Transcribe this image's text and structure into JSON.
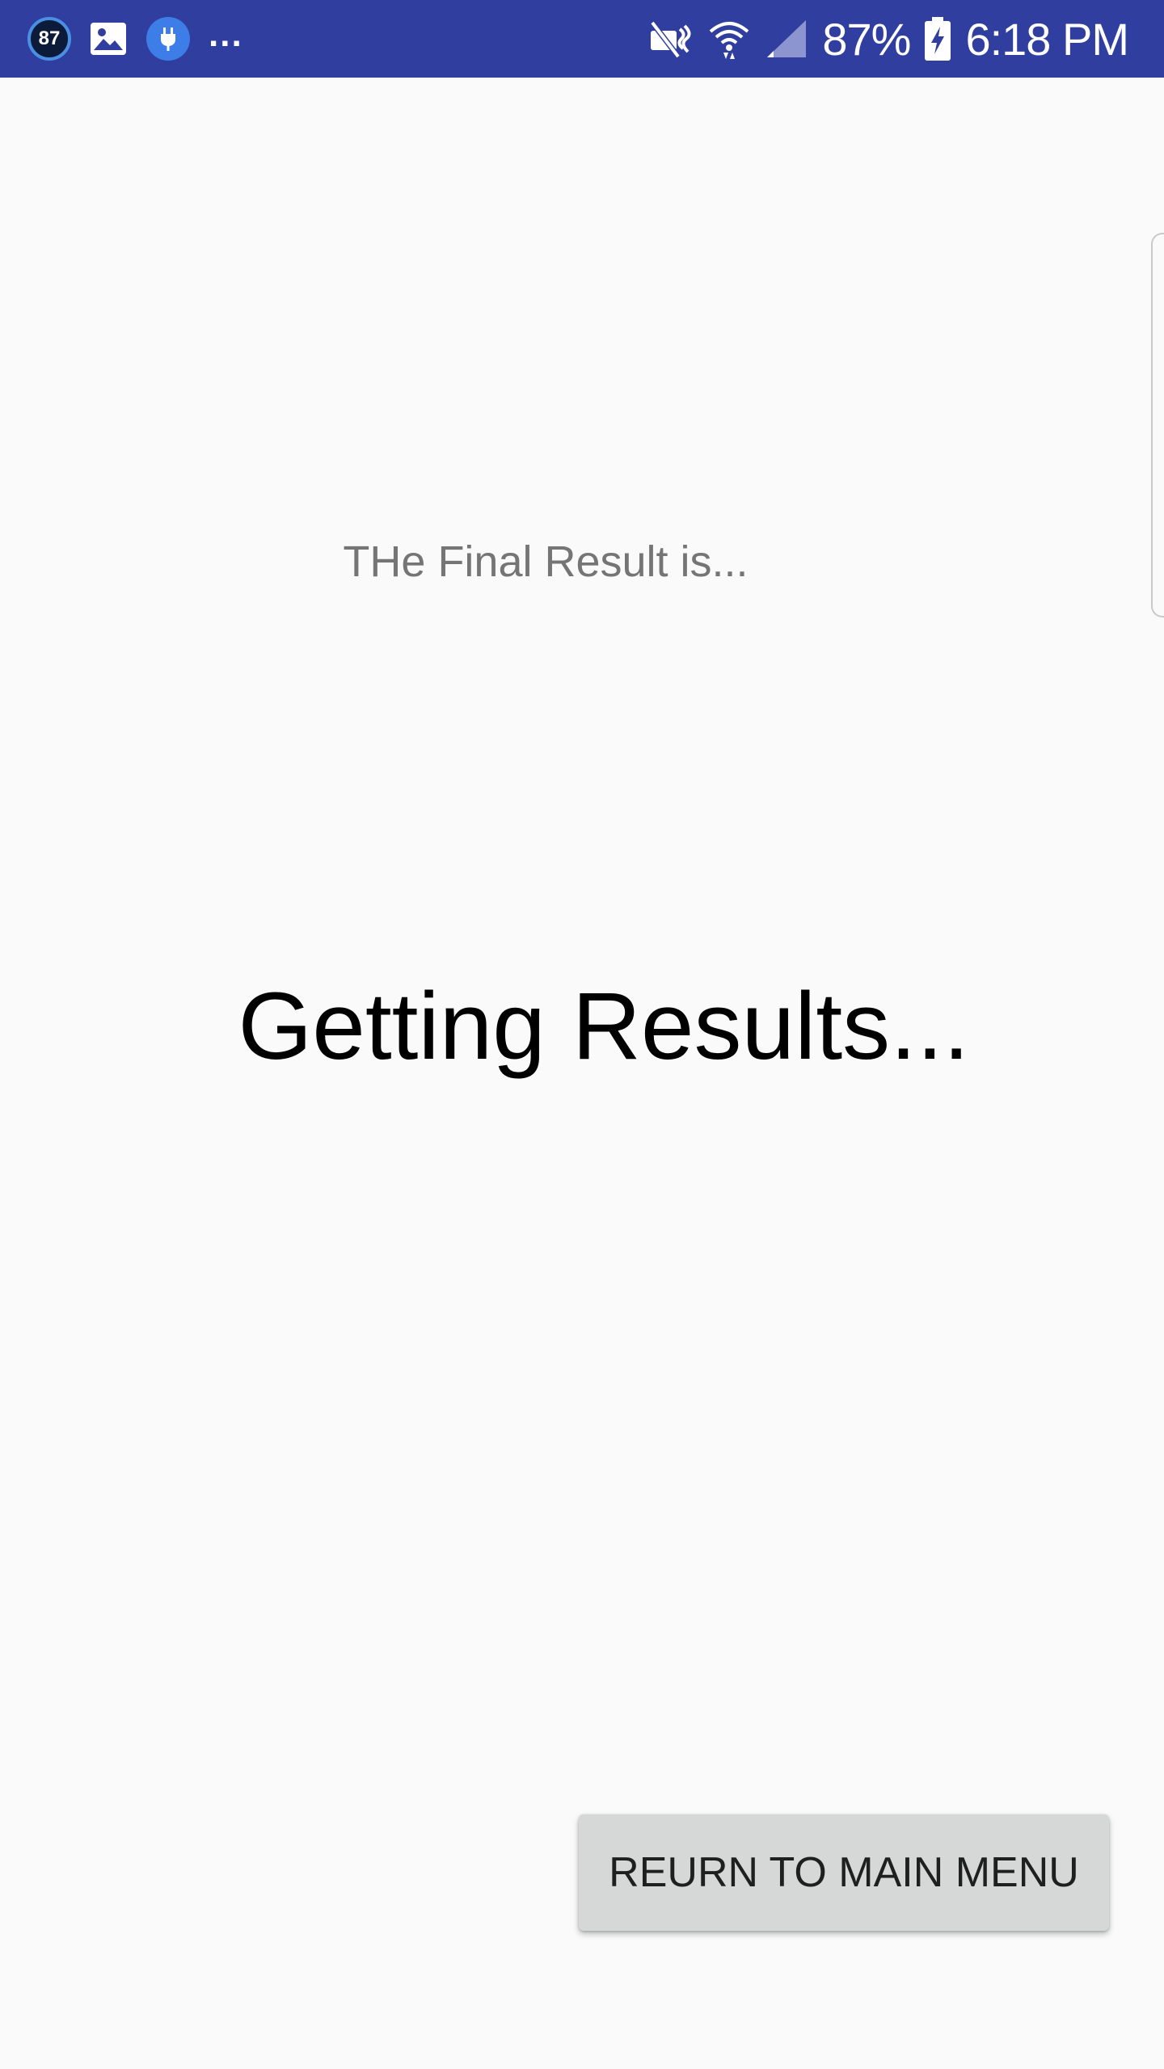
{
  "status_bar": {
    "notification_badge": "87",
    "more_notifications": "...",
    "battery_percent": "87%",
    "time": "6:18 PM",
    "icons": [
      "gallery-icon",
      "plug-icon",
      "mute-icon",
      "wifi-icon",
      "signal-icon",
      "battery-charging-icon"
    ]
  },
  "main": {
    "subtitle": "THe Final Result is...",
    "heading": "Getting Results...",
    "return_button_label": "REURN TO MAIN MENU"
  },
  "colors": {
    "status_bar": "#303f9f",
    "background": "#fafafa",
    "button": "#d6d7d7"
  }
}
